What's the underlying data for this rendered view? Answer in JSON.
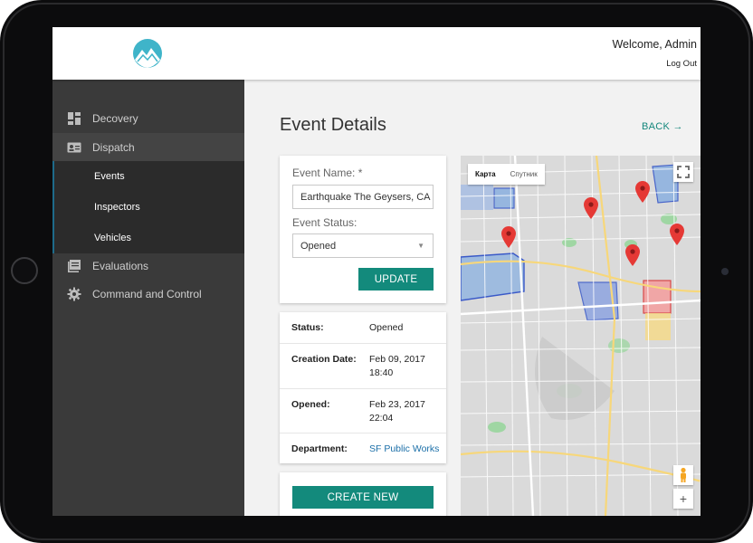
{
  "header": {
    "welcome": "Welcome, Admin",
    "logout": "Log Out"
  },
  "sidebar": {
    "items": [
      {
        "label": "Decovery",
        "icon": "dashboard-icon"
      },
      {
        "label": "Dispatch",
        "icon": "id-card-icon"
      },
      {
        "label": "Evaluations",
        "icon": "library-icon"
      },
      {
        "label": "Command and Control",
        "icon": "gear-icon"
      }
    ],
    "sub_items": [
      "Events",
      "Inspectors",
      "Vehicles"
    ]
  },
  "main": {
    "title": "Event Details",
    "back": "BACK →"
  },
  "form": {
    "event_name_label": "Event Name: *",
    "event_name_value": "Earthquake The Geysers, CA",
    "event_status_label": "Event Status:",
    "event_status_value": "Opened",
    "update_label": "UPDATE"
  },
  "info": {
    "status_key": "Status:",
    "status_val": "Opened",
    "creation_key": "Creation Date:",
    "creation_date": "Feb 09, 2017",
    "creation_time": "18:40",
    "opened_key": "Opened:",
    "opened_date": "Feb 23, 2017",
    "opened_time": "22:04",
    "department_key": "Department:",
    "department_val": "SF Public Works"
  },
  "create_new_label": "CREATE NEW",
  "map": {
    "toggle_map": "Карта",
    "toggle_satellite": "Спутник",
    "zoom_in": "+"
  },
  "colors": {
    "accent": "#138a7c",
    "sidebar": "#3a3a3a",
    "link": "#1b6fa8",
    "marker": "#e53935"
  }
}
